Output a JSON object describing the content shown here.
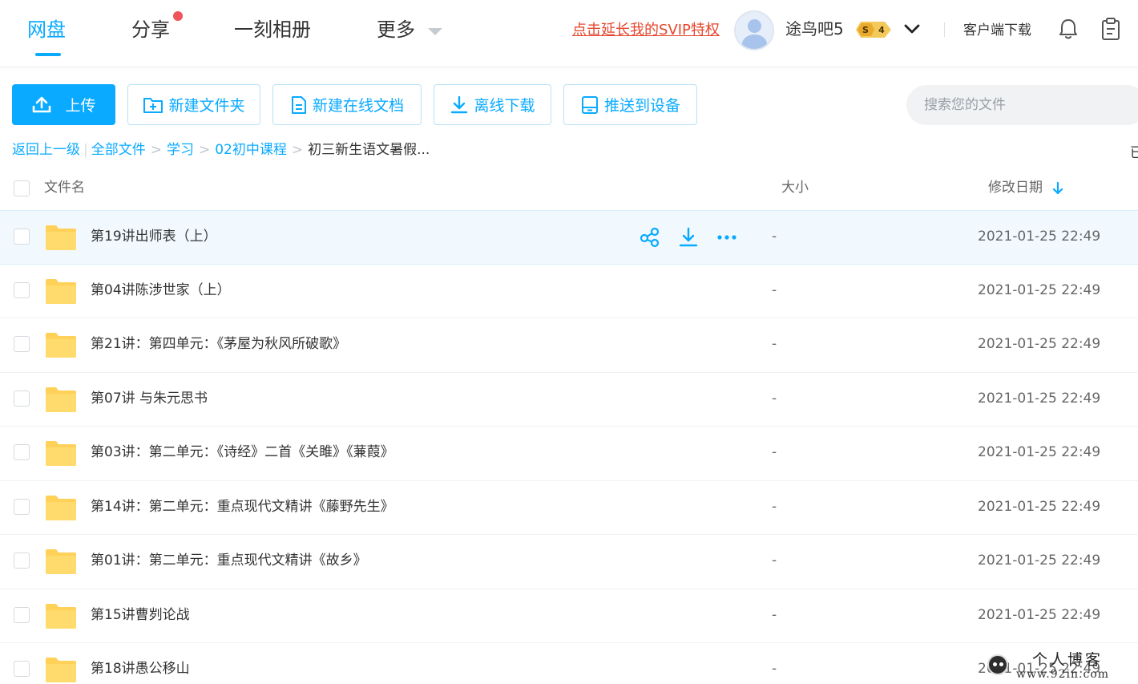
{
  "nav": {
    "items": [
      {
        "label": "网盘",
        "active": true
      },
      {
        "label": "分享",
        "has_dot": true
      },
      {
        "label": "一刻相册"
      },
      {
        "label": "更多"
      }
    ],
    "svip_link": "点击延长我的SVIP特权",
    "username": "途鸟吧5",
    "vip_level": "4",
    "vip_symbol": "S",
    "client_download": "客户端下载",
    "icons": [
      "bell-icon",
      "clipboard-icon",
      "chevron-down-icon"
    ]
  },
  "toolbar": {
    "upload": "上传",
    "new_folder": "新建文件夹",
    "new_online_doc": "新建在线文档",
    "offline_download": "离线下载",
    "push_to_device": "推送到设备",
    "search_placeholder": "搜索您的文件"
  },
  "breadcrumb": {
    "back": "返回上一级",
    "items": [
      "全部文件",
      "学习",
      "02初中课程"
    ],
    "current": "初三新生语文暑假...",
    "edge_text": "已"
  },
  "table": {
    "headers": {
      "name": "文件名",
      "size": "大小",
      "date": "修改日期"
    },
    "sort": "date-descending",
    "rows": [
      {
        "name": "第19讲出师表（上）",
        "size": "-",
        "date": "2021-01-25 22:49",
        "hovered": true
      },
      {
        "name": "第04讲陈涉世家（上）",
        "size": "-",
        "date": "2021-01-25 22:49"
      },
      {
        "name": "第21讲：第四单元：《茅屋为秋风所破歌》",
        "size": "-",
        "date": "2021-01-25 22:49"
      },
      {
        "name": "第07讲 与朱元思书",
        "size": "-",
        "date": "2021-01-25 22:49"
      },
      {
        "name": "第03讲：第二单元：《诗经》二首《关雎》《蒹葭》",
        "size": "-",
        "date": "2021-01-25 22:49"
      },
      {
        "name": "第14讲：第二单元：重点现代文精讲《藤野先生》",
        "size": "-",
        "date": "2021-01-25 22:49"
      },
      {
        "name": "第01讲：第二单元：重点现代文精讲《故乡》",
        "size": "-",
        "date": "2021-01-25 22:49"
      },
      {
        "name": "第15讲曹刿论战",
        "size": "-",
        "date": "2021-01-25 22:49"
      },
      {
        "name": "第18讲愚公移山",
        "size": "-",
        "date": "2021-01-25 22:49"
      }
    ],
    "row_actions": [
      "share-icon",
      "download-icon",
      "more-icon"
    ]
  },
  "watermark": {
    "title": "个人博客",
    "url": "www.92in.com"
  },
  "colors": {
    "accent": "#09aaff",
    "svip_link": "#e5462d",
    "folder": "#ffd159",
    "hover_row": "#f1f9ff",
    "notify_dot": "#f0535a"
  }
}
